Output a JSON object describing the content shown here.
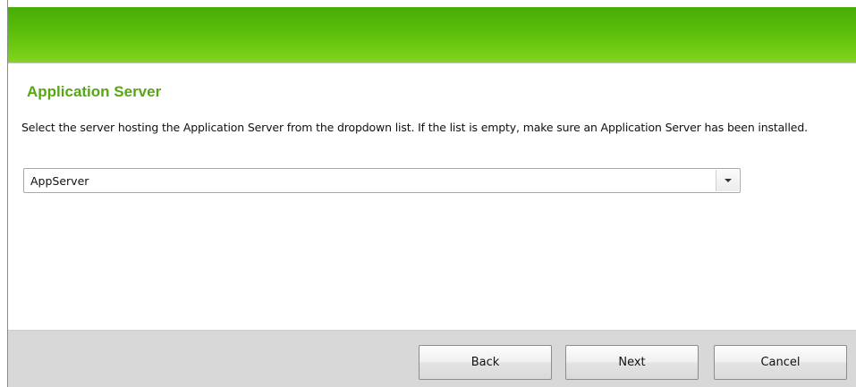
{
  "page": {
    "title": "Application Server",
    "instructions": "Select the server hosting the Application Server from the dropdown list. If the list is empty, make sure an Application Server has been installed."
  },
  "server_select": {
    "value": "AppServer",
    "icon": "chevron-down-icon"
  },
  "buttons": {
    "back": "Back",
    "next": "Next",
    "cancel": "Cancel"
  },
  "colors": {
    "banner_green": "#5cbe0a",
    "title_green": "#56a712",
    "footer_gray": "#d8d8d8"
  }
}
